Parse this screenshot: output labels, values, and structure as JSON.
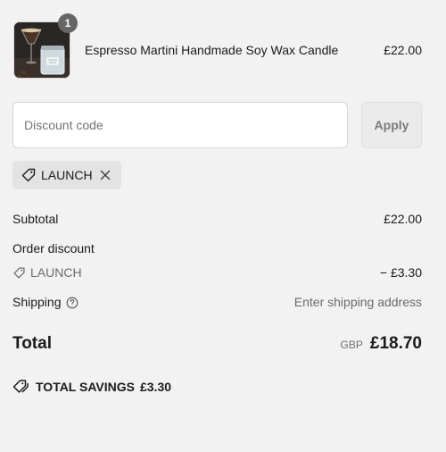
{
  "product": {
    "quantity": "1",
    "name": "Espresso Martini Handmade Soy Wax Candle",
    "price": "£22.00",
    "image_icon": "candle-product-image"
  },
  "discount_form": {
    "placeholder": "Discount code",
    "apply_label": "Apply"
  },
  "applied_code": {
    "code": "LAUNCH",
    "tag_icon": "tag-icon",
    "remove_icon": "close-icon"
  },
  "summary": {
    "subtotal_label": "Subtotal",
    "subtotal_value": "£22.00",
    "order_discount_label": "Order discount",
    "discount_code": "LAUNCH",
    "discount_value": "− £3.30",
    "shipping_label": "Shipping",
    "shipping_value": "Enter shipping address",
    "total_label": "Total",
    "currency": "GBP",
    "total_value": "£18.70"
  },
  "savings": {
    "label": "TOTAL SAVINGS",
    "value": "£3.30"
  },
  "colors": {
    "background": "#f2f2f2",
    "badge": "#666666",
    "tag_background": "#e3e3e3"
  }
}
